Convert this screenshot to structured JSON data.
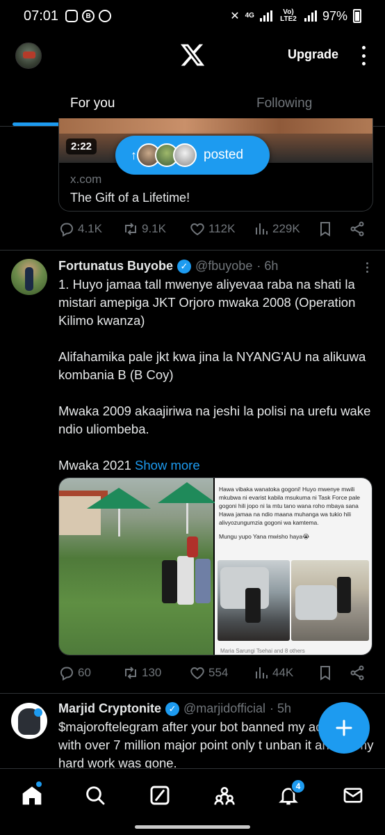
{
  "status_bar": {
    "time": "07:01",
    "network_top": "4G",
    "network_bottom": "Vo) LTE2",
    "battery": "97%"
  },
  "header": {
    "upgrade_label": "Upgrade"
  },
  "tabs": [
    {
      "label": "For you",
      "active": true
    },
    {
      "label": "Following",
      "active": false
    }
  ],
  "post1": {
    "duration": "2:22",
    "card_domain": "x.com",
    "card_title": "The Gift of a Lifetime!",
    "posted_label": "posted",
    "posted_arrow": "↑",
    "replies": "4.1K",
    "reposts": "9.1K",
    "likes": "112K",
    "views": "229K"
  },
  "post2": {
    "name": "Fortunatus Buyobe",
    "handle": "@fbuyobe",
    "time": "· 6h",
    "text_p1": "1. Huyo jamaa tall mwenye aliyevaa raba na shati la mistari amepiga JKT Orjoro mwaka 2008 (Operation Kilimo kwanza)",
    "text_p2": "Alifahamika pale jkt kwa jina la NYANG'AU na alikuwa kombania B (B Coy)",
    "text_p3": "Mwaka 2009 akaajiriwa na jeshi la polisi na urefu wake ndio uliombeba.",
    "text_p4": "Mwaka 2021",
    "show_more": "Show more",
    "media_right_text": "Hawa vibaka wanatoka gogoni! Huyo mwenye mwili mkubwa ni evarist kabila msukuma ni Task Force pale gogoni hili jopo ni la mtu tano wana roho mbaya sana Hawa jamaa na ndio maana muhanga wa tukio hili alivyozungumzia gogoni wa kamtema.",
    "media_right_text2": "Mungu yupo Yana mwisho haya😭",
    "media_right_footer": "Maria Sarungi Tsehai and 8 others",
    "replies": "60",
    "reposts": "130",
    "likes": "554",
    "views": "44K"
  },
  "post3": {
    "name": "Marjid Cryptonite",
    "handle": "@marjidofficial",
    "time": "· 5h",
    "text": "$majoroftelegram after your bot banned my account with over 7 million major point only t unban it and all my hard work was gone."
  },
  "bottom_nav": {
    "notifications_badge": "4"
  },
  "colors": {
    "accent": "#1d9bf0",
    "background": "#000000",
    "text": "#e7e9ea",
    "muted": "#71767b",
    "divider": "#2f3336"
  }
}
